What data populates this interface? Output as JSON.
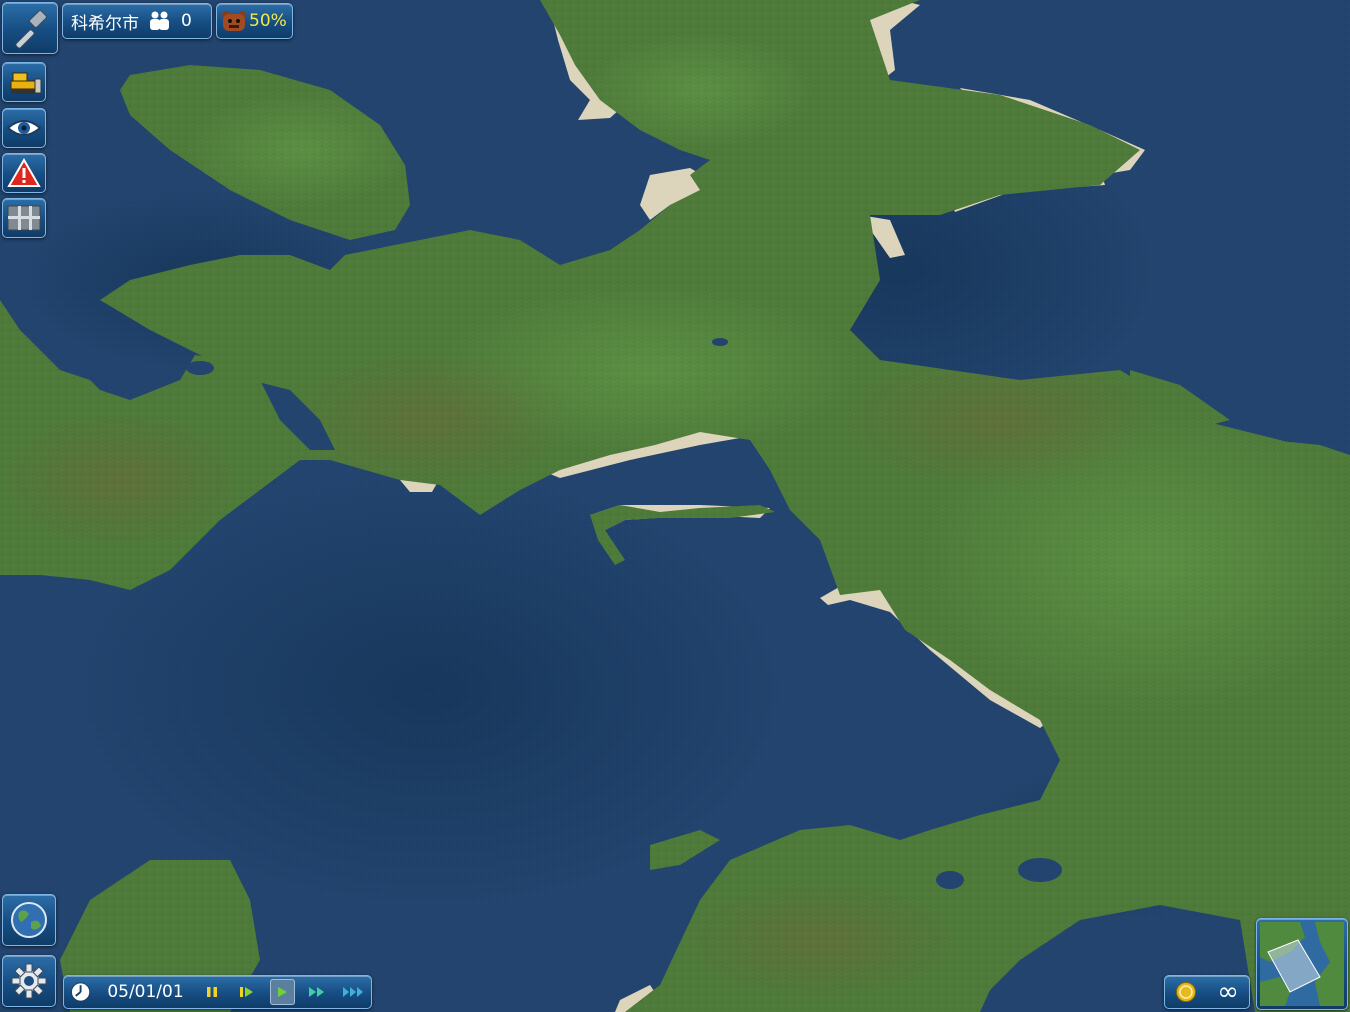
{
  "city": {
    "name": "科希尔市",
    "population": "0"
  },
  "approval": {
    "percent": "50%"
  },
  "clock": {
    "date": "05/01/01",
    "active_speed": "play"
  },
  "money": {
    "balance": "∞"
  },
  "toolbar": {
    "left_tools": [
      "hammer-icon",
      "bulldozer-icon",
      "eye-icon",
      "warning-icon",
      "road-grid-icon"
    ],
    "bottom_tools": [
      "globe-icon",
      "gear-icon"
    ],
    "speed_controls": [
      "pause",
      "step",
      "play",
      "fast",
      "fastest"
    ]
  },
  "colors": {
    "water": "#22446e",
    "land": "#4e7a3a",
    "beach": "#ddd5bb",
    "panel": "#164d82",
    "approval_text": "#f2e84a",
    "coin": "#e8b820"
  }
}
